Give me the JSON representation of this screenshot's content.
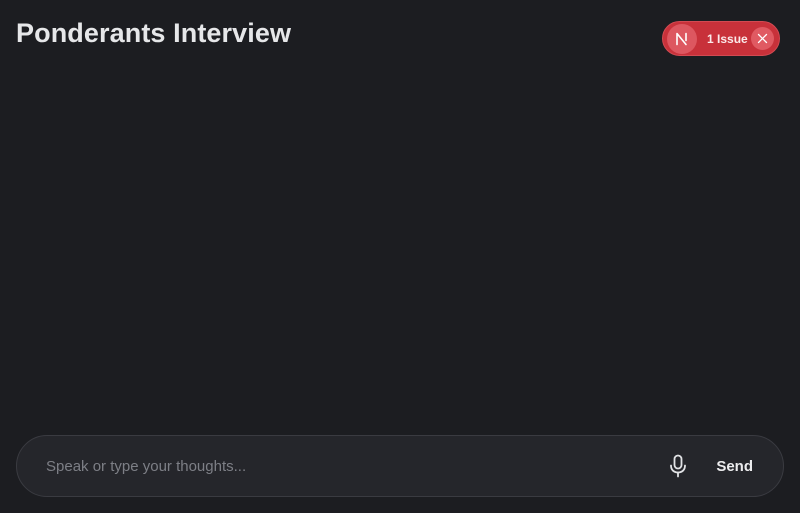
{
  "header": {
    "title": "Ponderants Interview"
  },
  "dev_overlay": {
    "badge_letter": "N",
    "issue_label": "1 Issue",
    "close_icon": "close-icon",
    "colors": {
      "pill_bg": "#c8313a",
      "badge_bg": "#dd5760"
    }
  },
  "composer": {
    "placeholder": "Speak or type your thoughts...",
    "value": "",
    "mic_icon": "microphone-icon",
    "send_label": "Send"
  },
  "theme": {
    "background": "#1c1d21",
    "composer_bg": "#25262b",
    "text": "#e6e7e9"
  }
}
